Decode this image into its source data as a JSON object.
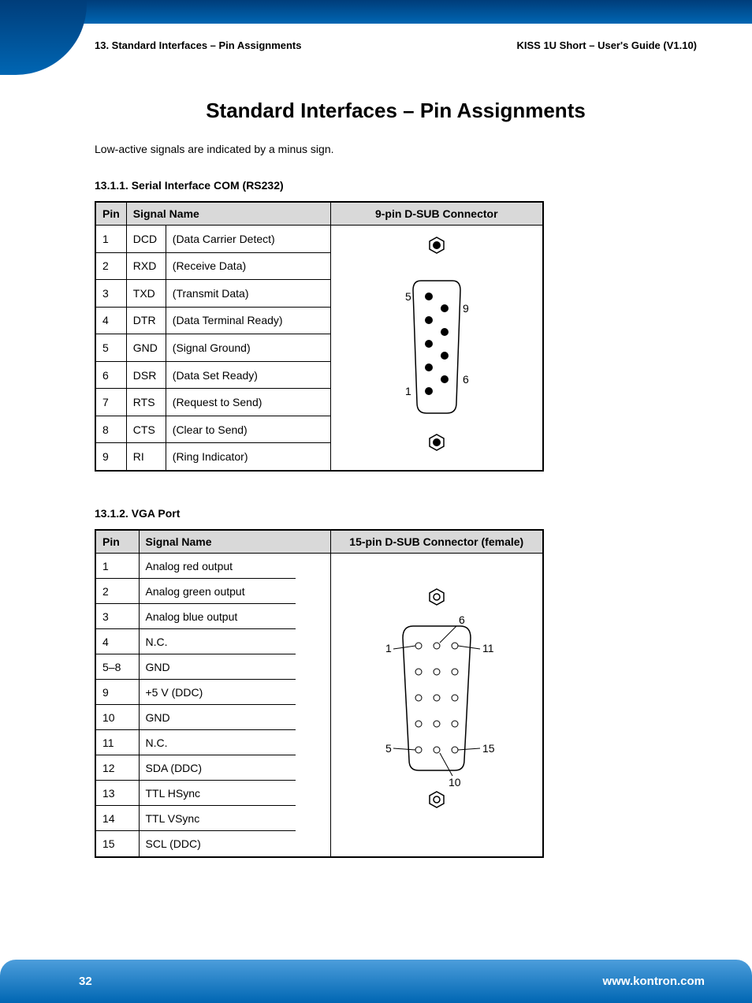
{
  "header": {
    "left": "13. Standard Interfaces – Pin Assignments",
    "right": "KISS 1U Short – User's Guide (V1.10)"
  },
  "title": "Standard Interfaces – Pin Assignments",
  "intro": "Low-active signals are indicated by a minus sign.",
  "section1": {
    "heading": "13.1.1. Serial Interface COM (RS232)",
    "headers": {
      "pin": "Pin",
      "signal": "Signal Name",
      "connector": "9-pin D-SUB Connector"
    },
    "rows": [
      {
        "pin": "1",
        "abbr": "DCD",
        "desc": "(Data Carrier Detect)"
      },
      {
        "pin": "2",
        "abbr": "RXD",
        "desc": "(Receive Data)"
      },
      {
        "pin": "3",
        "abbr": "TXD",
        "desc": "(Transmit Data)"
      },
      {
        "pin": "4",
        "abbr": "DTR",
        "desc": "(Data Terminal Ready)"
      },
      {
        "pin": "5",
        "abbr": "GND",
        "desc": "(Signal Ground)"
      },
      {
        "pin": "6",
        "abbr": "DSR",
        "desc": "(Data Set Ready)"
      },
      {
        "pin": "7",
        "abbr": "RTS",
        "desc": "(Request to Send)"
      },
      {
        "pin": "8",
        "abbr": "CTS",
        "desc": "(Clear to Send)"
      },
      {
        "pin": "9",
        "abbr": "RI",
        "desc": "(Ring Indicator)"
      }
    ],
    "diagram_labels": {
      "top_left": "5",
      "top_right": "9",
      "bot_left": "1",
      "bot_right": "6"
    }
  },
  "section2": {
    "heading": "13.1.2. VGA Port",
    "headers": {
      "pin": "Pin",
      "signal": "Signal Name",
      "connector": "15-pin D-SUB Connector (female)"
    },
    "rows": [
      {
        "pin": "1",
        "name": "Analog red output"
      },
      {
        "pin": "2",
        "name": "Analog green output"
      },
      {
        "pin": "3",
        "name": "Analog blue output"
      },
      {
        "pin": "4",
        "name": "N.C."
      },
      {
        "pin": "5–8",
        "name": "GND"
      },
      {
        "pin": "9",
        "name": "+5 V (DDC)"
      },
      {
        "pin": "10",
        "name": "GND"
      },
      {
        "pin": "11",
        "name": "N.C."
      },
      {
        "pin": "12",
        "name": "SDA (DDC)"
      },
      {
        "pin": "13",
        "name": "TTL HSync"
      },
      {
        "pin": "14",
        "name": "TTL VSync"
      },
      {
        "pin": "15",
        "name": "SCL (DDC)"
      }
    ],
    "diagram_labels": {
      "l1": "1",
      "l5": "5",
      "r6": "6",
      "r11": "11",
      "r15": "15",
      "b10": "10"
    }
  },
  "footer": {
    "page": "32",
    "url": "www.kontron.com"
  }
}
